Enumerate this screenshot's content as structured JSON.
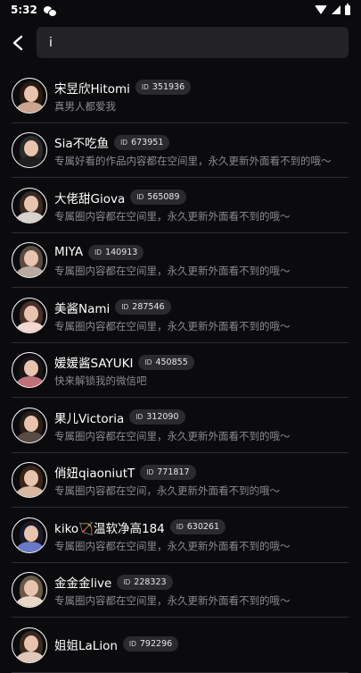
{
  "status_bar": {
    "time": "5:32",
    "icons": [
      "wechat-icon",
      "wifi-icon",
      "signal-icon",
      "battery-icon"
    ]
  },
  "search": {
    "value": "i"
  },
  "colors": {
    "background": "#0b0b0d",
    "search_bg": "#232326",
    "badge_bg": "#2b2b2f",
    "desc_text": "#8a8a90",
    "divider": "#2e2e33"
  },
  "results": [
    {
      "name": "宋昱欣Hitomi",
      "id_prefix": "ID",
      "id": "351936",
      "desc": "真男人都爱我",
      "hair": "#2a1a12",
      "body": "#c9a58f"
    },
    {
      "name": "Sia不吃鱼",
      "id_prefix": "ID",
      "id": "673951",
      "desc": "专属好看的作品内容都在空间里，永久更新外面看不到的哦～",
      "hair": "#2b2b2b",
      "body": "#1f1f1f"
    },
    {
      "name": "大佬甜Giova",
      "id_prefix": "ID",
      "id": "565089",
      "desc": "专属圈内容都在空间里，永久更新外面看不到的哦～",
      "hair": "#3a2a22",
      "body": "#d8d2cc"
    },
    {
      "name": "MIYA",
      "id_prefix": "ID",
      "id": "140913",
      "desc": "专属圈内容都在空间里，永久更新外面看不到的哦～",
      "hair": "#5a4a40",
      "body": "#b8aaa0"
    },
    {
      "name": "美酱Nami",
      "id_prefix": "ID",
      "id": "287546",
      "desc": "专属圈内容都在空间里，永久更新外面看不到的哦～",
      "hair": "#4a3028",
      "body": "#f1d8d0"
    },
    {
      "name": "媛媛酱SAYUKI",
      "id_prefix": "ID",
      "id": "450855",
      "desc": "快来解锁我的微信吧",
      "hair": "#1c1418",
      "body": "#c0707a"
    },
    {
      "name": "果儿Victoria",
      "id_prefix": "ID",
      "id": "312090",
      "desc": "专属圈内容都在空间里，永久更新外面看不到的哦～",
      "hair": "#2a1e18",
      "body": "#5a4a44"
    },
    {
      "name": "俏妞qiaoniutT",
      "id_prefix": "ID",
      "id": "771817",
      "desc": "专属圈内容都在空间，永久更新外面看不到的哦～",
      "hair": "#3a2418",
      "body": "#d8b8a0"
    },
    {
      "name": "kiko🏹温软净高184",
      "id_prefix": "ID",
      "id": "630261",
      "desc": "专属圈内容都在空间里，永久更新外面看不到的哦～",
      "hair": "#1a1a2a",
      "body": "#6a78c8"
    },
    {
      "name": "金金金live",
      "id_prefix": "ID",
      "id": "228323",
      "desc": "专属圈内容都在空间里，永久更新外面看不到的哦～",
      "hair": "#6a5848",
      "body": "#e8d8c8"
    },
    {
      "name": "姐姐LaLion",
      "id_prefix": "ID",
      "id": "792296",
      "desc": "",
      "hair": "#3a2a20",
      "body": "#e0c8b8"
    }
  ]
}
